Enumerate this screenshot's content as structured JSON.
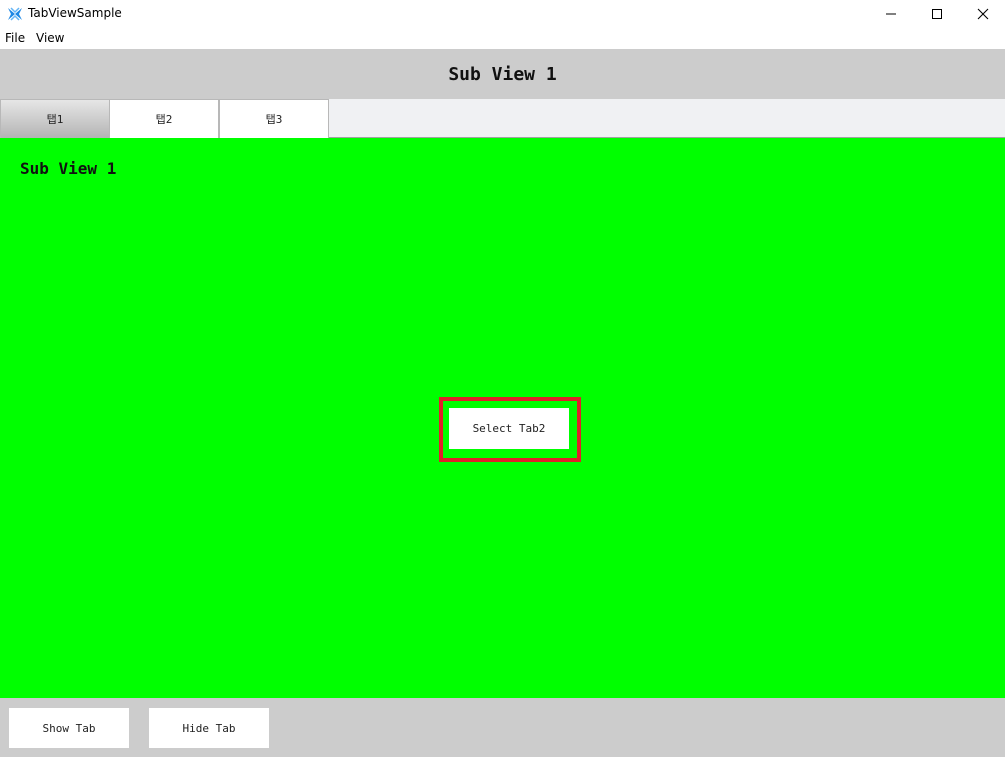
{
  "window": {
    "title": "TabViewSample",
    "icon": "app-logo-icon",
    "controls": [
      "minimize-icon",
      "maximize-icon",
      "close-icon"
    ]
  },
  "menu": {
    "items": [
      {
        "label": "File"
      },
      {
        "label": "View"
      }
    ]
  },
  "header": {
    "title": "Sub View 1"
  },
  "tabs": [
    {
      "label": "탭1",
      "selected": true
    },
    {
      "label": "탭2",
      "selected": false
    },
    {
      "label": "탭3",
      "selected": false
    }
  ],
  "content": {
    "title": "Sub View 1",
    "background_color": "#00ff00",
    "select_button_label": "Select Tab2",
    "highlight_color": "#e0202a"
  },
  "footer": {
    "show_tab_label": "Show Tab",
    "hide_tab_label": "Hide Tab"
  }
}
